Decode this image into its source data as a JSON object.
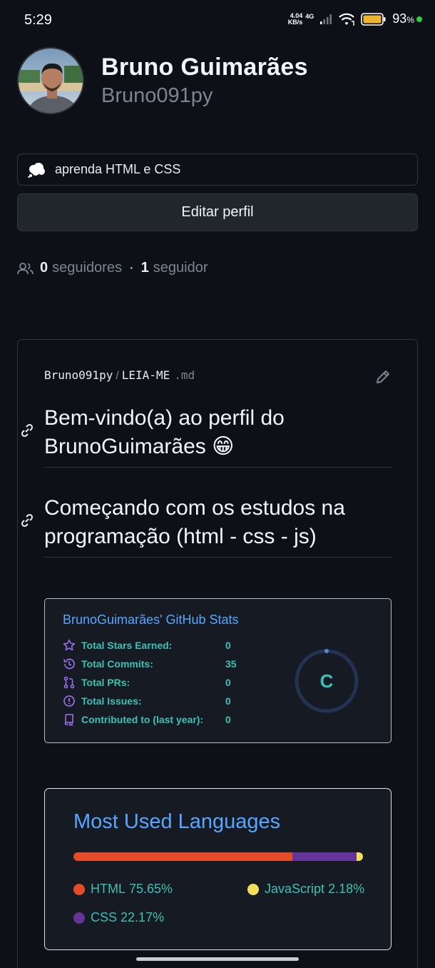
{
  "status_bar": {
    "time": "5:29",
    "net_speed_value": "4.04",
    "net_speed_unit": "KB/s",
    "network": "4G",
    "battery_percent": "93",
    "battery_suffix": "%",
    "colors": {
      "battery": "#f0b32e",
      "charge": "#2ecc40"
    }
  },
  "profile": {
    "full_name": "Bruno Guimarães",
    "username": "Bruno091py",
    "status_text": "aprenda HTML e CSS",
    "edit_button": "Editar perfil",
    "followers_count": "0",
    "followers_label": "seguidores",
    "separator": "·",
    "following_count": "1",
    "following_label": "seguidor"
  },
  "readme": {
    "owner": "Bruno091py",
    "separator": "/",
    "file": "LEIA-ME",
    "extension": ".md",
    "heading_1": "Bem-vindo(a) ao perfil do BrunoGuimarães 😁",
    "heading_2": "Começando com os estudos na programação (html - css - js)"
  },
  "stats_card": {
    "title": "BrunoGuimarães' GitHub Stats",
    "rows": [
      {
        "icon": "star-icon",
        "label": "Total Stars Earned:",
        "value": "0"
      },
      {
        "icon": "history-icon",
        "label": "Total Commits:",
        "value": "35"
      },
      {
        "icon": "pull-request-icon",
        "label": "Total PRs:",
        "value": "0"
      },
      {
        "icon": "issue-icon",
        "label": "Total Issues:",
        "value": "0"
      },
      {
        "icon": "repo-icon",
        "label": "Contributed to (last year):",
        "value": "0"
      }
    ],
    "grade": "C",
    "colors": {
      "title": "#58a6ff",
      "text": "#3ec1b5",
      "icon": "#a371f7",
      "ring": "#2a3a5c",
      "ring_progress": "#58a6ff"
    }
  },
  "languages_card": {
    "title": "Most Used Languages",
    "languages": [
      {
        "name": "HTML",
        "percent_text": "75.65%",
        "percent": 75.65,
        "color": "#e34c26"
      },
      {
        "name": "CSS",
        "percent_text": "22.17%",
        "percent": 22.17,
        "color": "#663399"
      },
      {
        "name": "JavaScript",
        "percent_text": "2.18%",
        "percent": 2.18,
        "color": "#f1e05a"
      }
    ]
  }
}
